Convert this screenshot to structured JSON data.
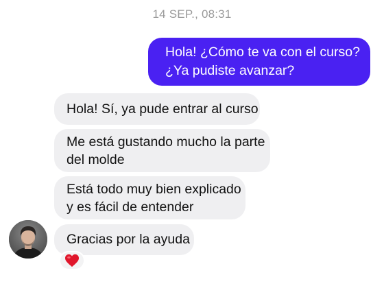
{
  "conversation": {
    "timestamp": "14 SEP., 08:31",
    "messages": [
      {
        "direction": "outgoing",
        "lines": [
          "Hola! ¿Cómo te va con el curso?",
          "¿Ya pudiste avanzar?"
        ]
      },
      {
        "direction": "incoming",
        "lines": [
          "Hola! Sí, ya pude entrar al curso"
        ]
      },
      {
        "direction": "incoming",
        "lines": [
          "Me está gustando mucho la parte",
          "del molde"
        ]
      },
      {
        "direction": "incoming",
        "lines": [
          "Está todo muy bien explicado",
          "y es fácil de entender"
        ]
      },
      {
        "direction": "incoming",
        "lines": [
          "Gracias por la ayuda"
        ],
        "reaction": "heart-emoji"
      }
    ]
  },
  "contact": {
    "avatar_icon": "person-photo"
  },
  "colors": {
    "outgoing_bubble": "#4a21f2",
    "incoming_bubble": "#efeff1",
    "timestamp_text": "#9a9a9a",
    "reaction_heart": "#e0162b"
  }
}
